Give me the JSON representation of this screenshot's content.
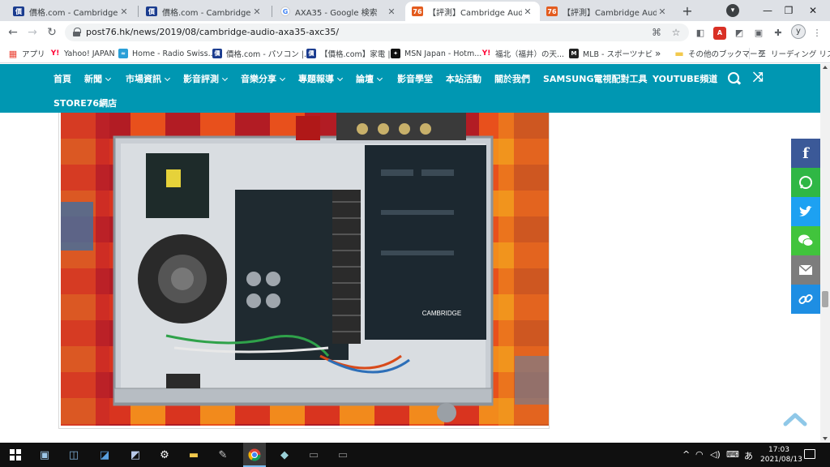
{
  "browser": {
    "tabs": [
      {
        "title": "價格.com - Cambridge Audio",
        "favicon": "kakaku-icon",
        "active": false
      },
      {
        "title": "價格.com - Cambridge Audio",
        "favicon": "kakaku-icon",
        "active": false
      },
      {
        "title": "AXA35 - Google 検索",
        "favicon": "google-icon",
        "active": false
      },
      {
        "title": "【評測】Cambridge Audio AXA",
        "favicon": "post76-icon",
        "active": true
      },
      {
        "title": "【評測】Cambridge Audio AX",
        "favicon": "post76-icon",
        "active": false
      }
    ],
    "url": "post76.hk/news/2019/08/cambridge-audio-axa35-axc35/",
    "profile_initial": "y",
    "bookmarks": [
      {
        "label": "アプリ",
        "icon": "apps-grid-icon"
      },
      {
        "label": "Yahoo! JAPAN",
        "icon": "yahoo-icon"
      },
      {
        "label": "Home - Radio Swiss...",
        "icon": "radio-swiss-icon"
      },
      {
        "label": "價格.com - パソコン |...",
        "icon": "kakaku-icon"
      },
      {
        "label": "【價格.com】家電 |...",
        "icon": "kakaku-icon"
      },
      {
        "label": "MSN Japan - Hotm...",
        "icon": "msn-icon"
      },
      {
        "label": "福北（福井）の天...",
        "icon": "yahoo-icon"
      },
      {
        "label": "MLB - スポーツナビ",
        "icon": "mlb-icon"
      }
    ],
    "bookmarks_overflow": "»",
    "other_bookmarks": "その他のブックマーク",
    "reading_list": "リーディング リスト"
  },
  "site_nav": {
    "items": [
      {
        "label": "首頁",
        "has_dropdown": false
      },
      {
        "label": "新聞",
        "has_dropdown": true
      },
      {
        "label": "市場資訊",
        "has_dropdown": true
      },
      {
        "label": "影音評測",
        "has_dropdown": true
      },
      {
        "label": "音樂分享",
        "has_dropdown": true
      },
      {
        "label": "專題報導",
        "has_dropdown": true
      },
      {
        "label": "論壇",
        "has_dropdown": true
      },
      {
        "label": "影音學堂",
        "has_dropdown": false
      },
      {
        "label": "本站活動",
        "has_dropdown": false
      },
      {
        "label": "關於我們",
        "has_dropdown": false
      },
      {
        "label": "SAMSUNG電視配對工具",
        "has_dropdown": false
      },
      {
        "label": "YOUTUBE頻道",
        "has_dropdown": false
      }
    ],
    "second_row": "STORE76網店",
    "accent_color": "#0097b2"
  },
  "share_buttons": [
    {
      "name": "facebook",
      "color": "#3b5998"
    },
    {
      "name": "whatsapp",
      "color": "#2fb745"
    },
    {
      "name": "twitter",
      "color": "#1da1f2"
    },
    {
      "name": "wechat",
      "color": "#41c43c"
    },
    {
      "name": "email",
      "color": "#7d7d7d"
    },
    {
      "name": "copy-link",
      "color": "#1e8ee3"
    }
  ],
  "photo": {
    "board_label": "CAMBRIDGE"
  },
  "taskbar": {
    "time": "17:03",
    "date": "2021/08/13",
    "ime": "あ"
  }
}
